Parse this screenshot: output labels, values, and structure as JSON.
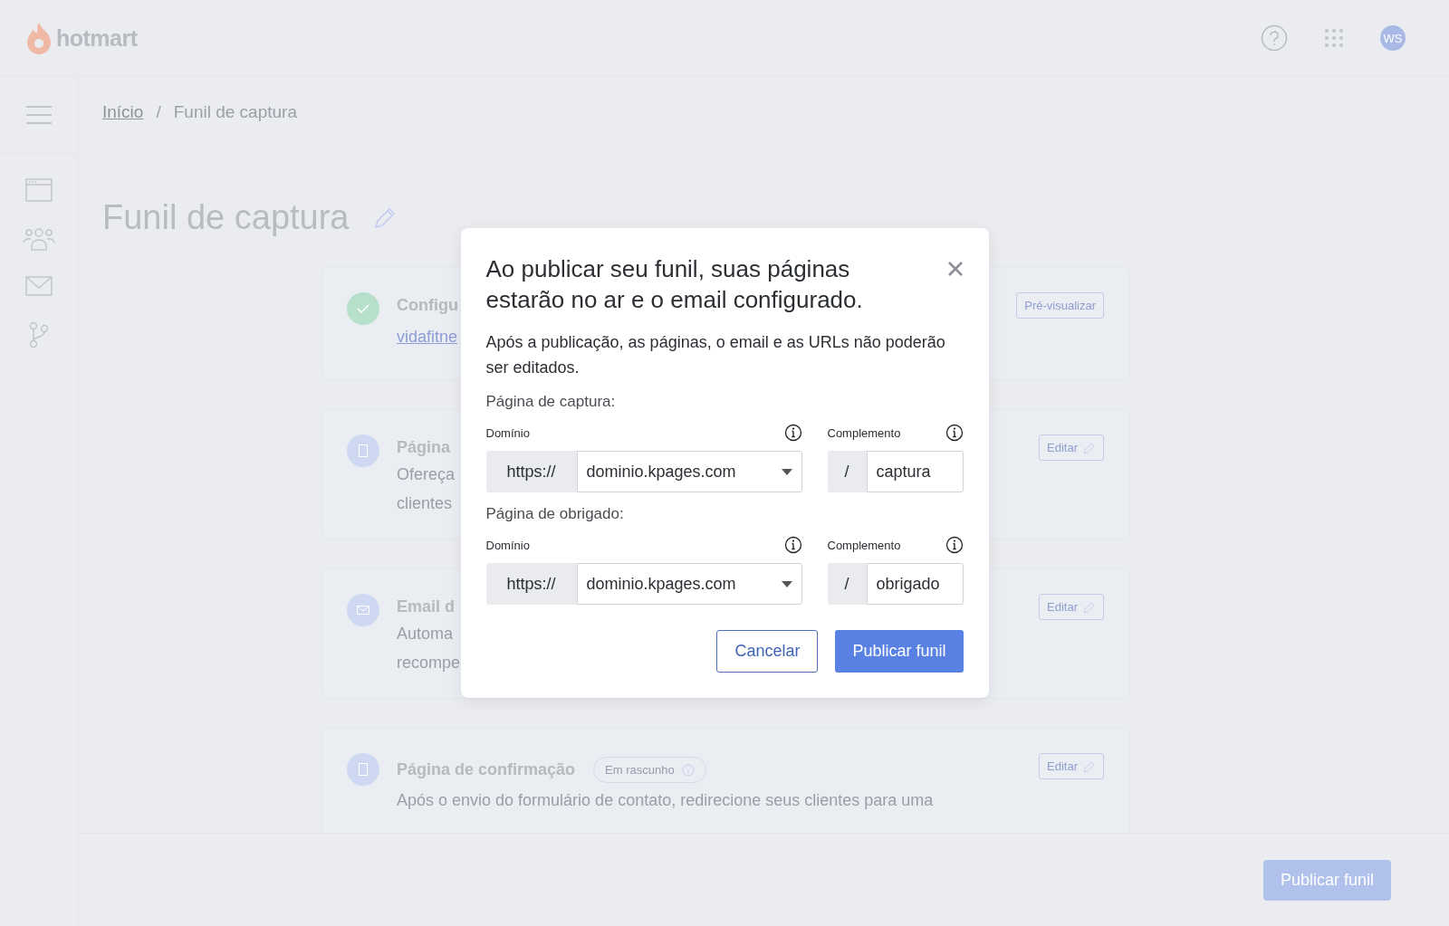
{
  "header": {
    "logo": "hotmart",
    "avatar": "WS"
  },
  "breadcrumb": {
    "separator": "/",
    "items": [
      {
        "label": "Início",
        "link": true
      },
      {
        "label": "Funil de captura",
        "link": false
      }
    ]
  },
  "page_title": "Funil de captura",
  "cards": [
    {
      "kind": "done",
      "title": "Configu",
      "link": "vidafitne",
      "action": {
        "kind": "preview",
        "label": "Pré-visualizar"
      }
    },
    {
      "kind": "page",
      "title": "Página",
      "lines": [
        "Ofereça",
        "clientes"
      ],
      "action": {
        "kind": "edit",
        "label": "Editar"
      }
    },
    {
      "kind": "email",
      "title": "Email d",
      "lines": [
        "Automa",
        "recompe"
      ],
      "action": {
        "kind": "edit",
        "label": "Editar"
      }
    },
    {
      "kind": "page",
      "title": "Página de confirmação",
      "badge": "Em rascunho",
      "lines": [
        "Após o envio do formulário de contato, redirecione seus clientes para uma"
      ],
      "action": {
        "kind": "edit",
        "label": "Editar"
      }
    }
  ],
  "footer": {
    "button": "Publicar funil",
    "disabled": true
  },
  "modal": {
    "title": "Ao publicar seu funil, suas páginas estarão no ar e o email configurado.",
    "description": "Após a publicação, as páginas, o email e as URLs não poderão ser editados.",
    "sections": [
      {
        "label": "Página de captura:",
        "domain": {
          "label": "Domínio",
          "prefix": "https://",
          "value": "dominio.kpages.com"
        },
        "path": {
          "label": "Complemento",
          "prefix": "/",
          "value": "captura"
        }
      },
      {
        "label": "Página de obrigado:",
        "domain": {
          "label": "Domínio",
          "prefix": "https://",
          "value": "dominio.kpages.com"
        },
        "path": {
          "label": "Complemento",
          "prefix": "/",
          "value": "obrigado"
        }
      }
    ],
    "buttons": [
      {
        "label": "Cancelar",
        "kind": "secondary"
      },
      {
        "label": "Publicar funil",
        "kind": "primary"
      }
    ]
  }
}
